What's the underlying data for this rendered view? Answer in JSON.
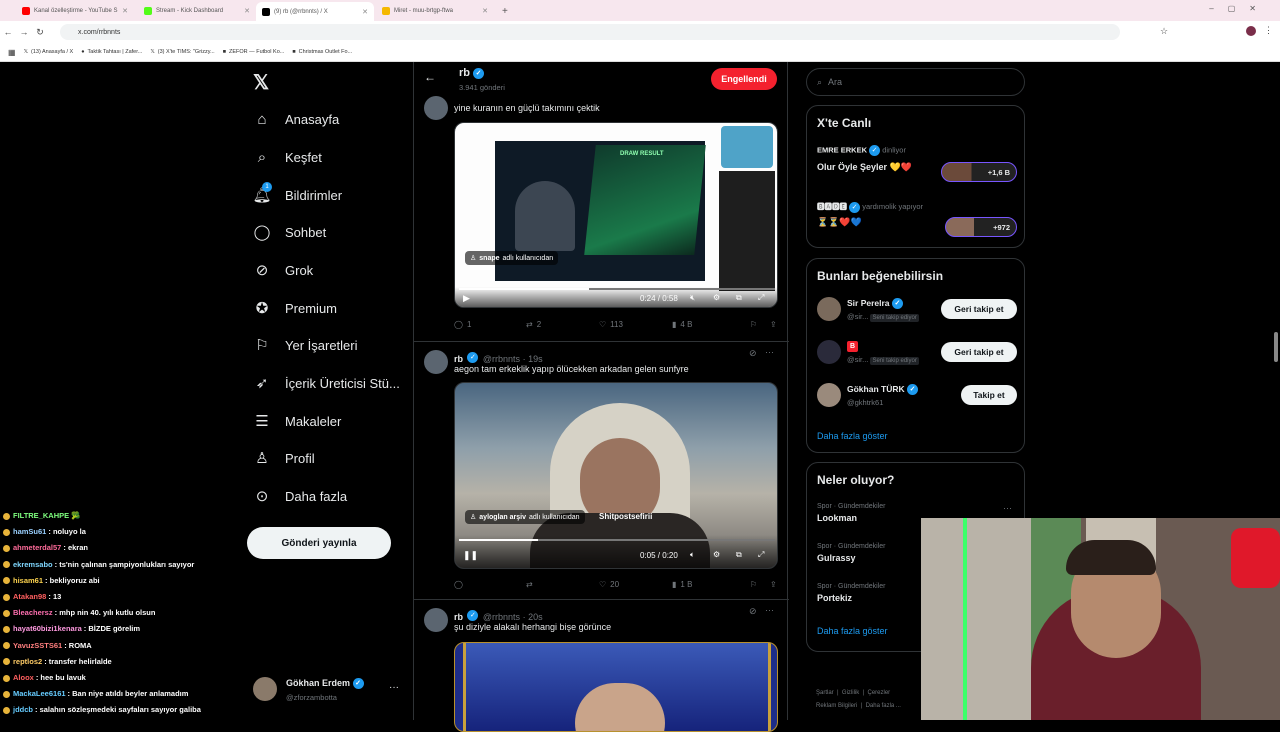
{
  "browser": {
    "tabs": [
      {
        "label": "Kanal özelleştirme - YouTube S",
        "color": "#ff0000"
      },
      {
        "label": "Stream - Kick Dashboard",
        "color": "#53fc18"
      },
      {
        "label": "(9) rb (@rrbnnts) / X",
        "color": "#000000"
      },
      {
        "label": "Miret - muu-brtgp-ftwa",
        "color": "#f5b800"
      }
    ],
    "url": "x.com/rrbnnts",
    "bookmarks": [
      "(13) Anasayfa / X",
      "Taktik Tahtası | Zafer...",
      "(3) X'te TIMS: \"Grizzy...",
      "ZEFOR — Futbol Ko...",
      "Christmas Outlet Fo..."
    ]
  },
  "nav": {
    "items": [
      {
        "label": "Anasayfa",
        "icon": "home-icon"
      },
      {
        "label": "Keşfet",
        "icon": "search-icon"
      },
      {
        "label": "Bildirimler",
        "icon": "bell-icon"
      },
      {
        "label": "Sohbet",
        "icon": "chat-icon"
      },
      {
        "label": "Grok",
        "icon": "grok-icon"
      },
      {
        "label": "Premium",
        "icon": "premium-icon"
      },
      {
        "label": "Yer İşaretleri",
        "icon": "bookmark-icon"
      },
      {
        "label": "İçerik Üreticisi Stü...",
        "icon": "rocket-icon"
      },
      {
        "label": "Makaleler",
        "icon": "article-icon"
      },
      {
        "label": "Profil",
        "icon": "profile-icon"
      },
      {
        "label": "Daha fazla",
        "icon": "more-icon"
      }
    ],
    "notif_count": "1",
    "post_button": "Gönderi yayınla",
    "account_name": "Gökhan Erdem",
    "account_handle": "@zforzambotta"
  },
  "profile_header": {
    "name": "rb",
    "posts": "3.941 gönderi",
    "blocked_button": "Engellendi"
  },
  "tweets": [
    {
      "text": "yine kuranın en güçlü takımını çektik",
      "overlay_user": "snape",
      "overlay_suffix": "adlı kullanıcıdan",
      "time": "0:24 / 0:58",
      "stats": {
        "reply": "1",
        "retweet": "2",
        "like": "113",
        "views": "4 B"
      },
      "media_text": "DRAW RESULT"
    },
    {
      "name": "rb",
      "handle": "@rrbnnts",
      "age": "19s",
      "text": "aegon tam erkeklik yapıp ölücekken arkadan gelen sunfyre",
      "overlay_user": "ayloglan arşiv",
      "overlay_suffix": "adlı kullanıcıdan",
      "overlay_extra": "Shitpostsefirii",
      "time": "0:05 / 0:20",
      "stats": {
        "reply": "",
        "retweet": "",
        "like": "20",
        "views": "1 B"
      }
    },
    {
      "name": "rb",
      "handle": "@rrbnnts",
      "age": "20s",
      "text": "şu diziyle alakalı herhangi bişe görünce"
    }
  ],
  "right": {
    "search_placeholder": "Ara",
    "live": {
      "title": "X'te Canlı",
      "items": [
        {
          "host": "EMRE ERKEK",
          "status": "dinliyor",
          "title": "Olur Öyle Şeyler 💛❤️",
          "count": "+1,6 B"
        },
        {
          "host": "🅱🅰🅳🅴",
          "status": "yardımolik yapıyor",
          "title": "⏳⏳❤️💙",
          "count": "+972"
        }
      ]
    },
    "suggest": {
      "title": "Bunları beğenebilirsin",
      "users": [
        {
          "name": "Sir Perelra",
          "handle": "@sir...",
          "badge": "Seni takip ediyor",
          "button": "Geri takip et"
        },
        {
          "name": "B",
          "handle": "@sir...",
          "badge": "Seni takip ediyor",
          "button": "Geri takip et"
        },
        {
          "name": "Gökhan TÜRK",
          "handle": "@gkhtrk61",
          "badge": "",
          "button": "Takip et"
        }
      ],
      "more": "Daha fazla göster"
    },
    "trends": {
      "title": "Neler oluyor?",
      "items": [
        {
          "category": "Spor · Gündemdekiler",
          "name": "Lookman"
        },
        {
          "category": "Spor · Gündemdekiler",
          "name": "Gulrassy"
        },
        {
          "category": "Spor · Gündemdekiler",
          "name": "Portekiz"
        }
      ],
      "more": "Daha fazla göster"
    },
    "footer": [
      "Şartlar",
      "Gizlilik",
      "Çerezler",
      "Reklam Bilgileri",
      "Daha fazla ..."
    ]
  },
  "chat": [
    {
      "user": "FILTRE_KAHPE",
      "msg": "🥦",
      "color": "#7fff7f"
    },
    {
      "user": "hamSu61",
      "msg": ": noluyo la",
      "color": "#9ad0ff"
    },
    {
      "user": "ahmeterdal57",
      "msg": ": ekran",
      "color": "#ff6b9a"
    },
    {
      "user": "ekremsabo",
      "msg": ": ts'nin çalınan şampiyonlukları sayıyor",
      "color": "#7fd7ff"
    },
    {
      "user": "hisam61",
      "msg": ": bekliyoruz abi",
      "color": "#ffd54f"
    },
    {
      "user": "Atakan98",
      "msg": ": 13",
      "color": "#ff5f5f"
    },
    {
      "user": "Bleachersz",
      "msg": ": mhp nin 40. yılı kutlu olsun",
      "color": "#ff6fb0"
    },
    {
      "user": "hayat60bizi1kenara",
      "msg": ": BİZDE görelim",
      "color": "#ff9ae0"
    },
    {
      "user": "YavuzSSTS61",
      "msg": ": ROMA",
      "color": "#ff7f7f"
    },
    {
      "user": "reptlos2",
      "msg": ": transfer helirlalde",
      "color": "#ffcc66"
    },
    {
      "user": "Aloox",
      "msg": ": hee bu lavuk",
      "color": "#ff5f5f"
    },
    {
      "user": "MackaLee6161",
      "msg": ": Ban niye atıldı beyler anlamadım",
      "color": "#66ccff"
    },
    {
      "user": "jddcb",
      "msg": ": salahın sözleşmedeki sayfaları sayıyor galiba",
      "color": "#66ccff"
    }
  ]
}
